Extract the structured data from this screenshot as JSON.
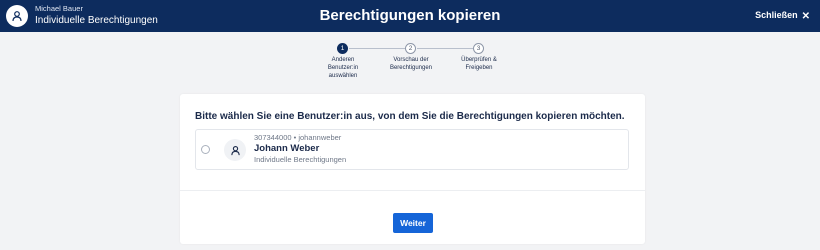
{
  "header": {
    "user_name": "Michael Bauer",
    "user_subtitle": "Individuelle Berechtigungen",
    "title": "Berechtigungen kopieren",
    "close_label": "Schließen",
    "close_icon": "✕"
  },
  "stepper": {
    "current_step": 1,
    "steps": [
      {
        "number": "1",
        "label": "Anderen Benutzer:in auswählen"
      },
      {
        "number": "2",
        "label": "Vorschau der Berechtigungen"
      },
      {
        "number": "3",
        "label": "Überprüfen & Freigeben"
      }
    ]
  },
  "card": {
    "heading": "Bitte wählen Sie eine Benutzer:in aus, von dem Sie die Berechtigungen kopieren möchten.",
    "option": {
      "meta": "307344000 • johannweber",
      "name": "Johann Weber",
      "subtitle": "Individuelle Berechtigungen",
      "selected": false
    },
    "next_label": "Weiter"
  },
  "colors": {
    "header_bg": "#0d2c5e",
    "primary_button": "#1565d8",
    "page_bg": "#f2f3f5"
  }
}
